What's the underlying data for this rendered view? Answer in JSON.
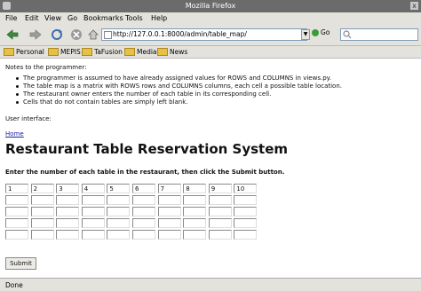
{
  "window": {
    "title": "Mozilla Firefox",
    "close_glyph": "x"
  },
  "menu": [
    "File",
    "Edit",
    "View",
    "Go",
    "Bookmarks",
    "Tools",
    "Help"
  ],
  "nav": {
    "back_icon": "back-arrow-icon",
    "forward_icon": "forward-arrow-icon",
    "reload_icon": "reload-icon",
    "stop_icon": "stop-icon",
    "home_icon": "home-icon",
    "url": "http://127.0.0.1:8000/admin/table_map/",
    "go_label": "Go"
  },
  "bookmarks": [
    "Personal",
    "MEPIS",
    "TaFusion",
    "Media",
    "News"
  ],
  "content": {
    "notes_heading": "Notes to the programmer:",
    "notes": [
      "The programmer is assumed to have already assigned values for ROWS and COLUMNS in views.py.",
      "The table map is a matrix with ROWS rows and COLUMNS columns, each cell a possible table location.",
      "The restaurant owner enters the number of each table in its corresponding cell.",
      "Cells that do not contain tables are simply left blank."
    ],
    "ui_label": "User interface:",
    "home_link": "Home",
    "heading": "Restaurant Table Reservation System",
    "instructions": "Enter the number of each table in the restaurant, then click the Submit button.",
    "grid": [
      [
        "1",
        "2",
        "3",
        "4",
        "5",
        "6",
        "7",
        "8",
        "9",
        "10"
      ],
      [
        "",
        "",
        "",
        "",
        "",
        "",
        "",
        "",
        "",
        ""
      ],
      [
        "",
        "",
        "",
        "",
        "",
        "",
        "",
        "",
        "",
        ""
      ],
      [
        "",
        "",
        "",
        "",
        "",
        "",
        "",
        "",
        "",
        ""
      ],
      [
        "",
        "",
        "",
        "",
        "",
        "",
        "",
        "",
        "",
        ""
      ]
    ],
    "submit_label": "Submit"
  },
  "status": {
    "text": "Done"
  },
  "colors": {
    "link": "#1a1aa6",
    "titlebar": "#6b6b6b",
    "chrome": "#e4e2dc"
  }
}
